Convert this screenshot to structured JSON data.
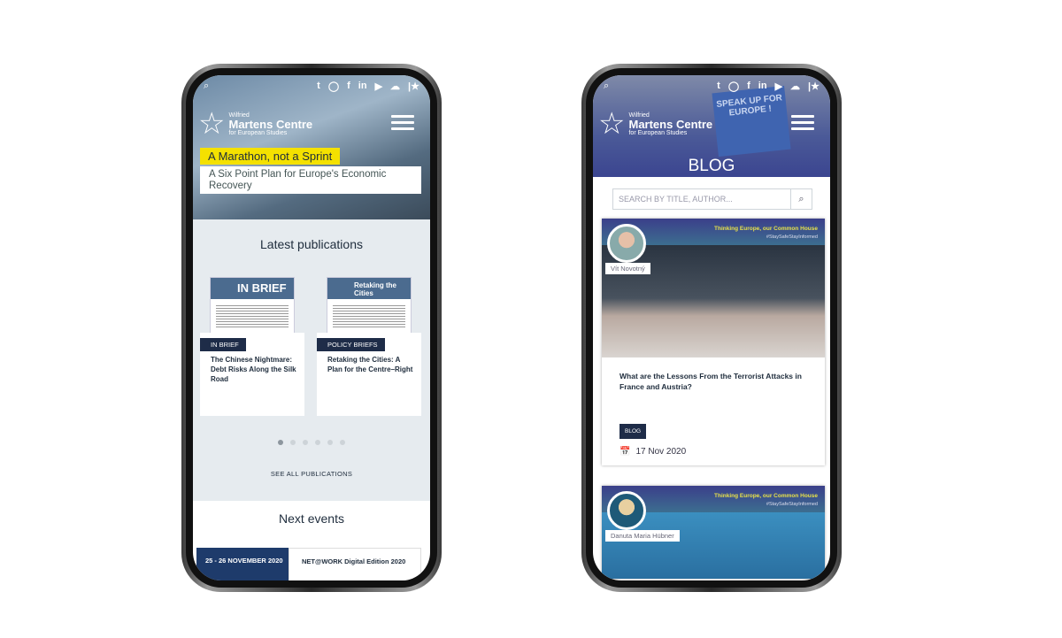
{
  "social_icons": [
    "twitter-icon",
    "instagram-icon",
    "facebook-icon",
    "linkedin-icon",
    "youtube-icon",
    "soundcloud-icon",
    "star-icon"
  ],
  "logo": {
    "line1": "Wilfried",
    "line2": "Martens Centre",
    "line3": "for European Studies"
  },
  "left": {
    "hero": {
      "headline": "A Marathon, not a Sprint",
      "subtitle": "A Six Point Plan for Europe's Economic Recovery"
    },
    "latest_title": "Latest publications",
    "publications": [
      {
        "category": "IN BRIEF",
        "title": "The Chinese Nightmare: Debt Risks Along the Silk Road",
        "cover": "IN BRIEF"
      },
      {
        "category": "POLICY BRIEFS",
        "title": "Retaking the Cities: A Plan for the Centre–Right",
        "cover": "Retaking the Cities"
      }
    ],
    "carousel": {
      "total": 6,
      "active": 1
    },
    "see_all": "SEE ALL PUBLICATIONS",
    "events_title": "Next events",
    "event": {
      "date": "25 - 26 NOVEMBER 2020",
      "name": "NET@WORK Digital Edition 2020"
    }
  },
  "right": {
    "poster": "SPEAK UP FOR EUROPE !",
    "page_title": "BLOG",
    "search_placeholder": "SEARCH BY TITLE, AUTHOR...",
    "banner": {
      "title": "Thinking Europe, our Common House",
      "hashtag": "#StaySafeStayInformed"
    },
    "posts": [
      {
        "author": "Vít Novotný",
        "title": "What are the Lessons From the Terrorist Attacks in France and Austria?",
        "badge": "BLOG",
        "date": "17 Nov 2020"
      },
      {
        "author": "Danuta Maria Hübner"
      }
    ]
  },
  "colors": {
    "navy": "#1e2c48",
    "yellow": "#f4e100",
    "event_blue": "#1e3b6b"
  }
}
